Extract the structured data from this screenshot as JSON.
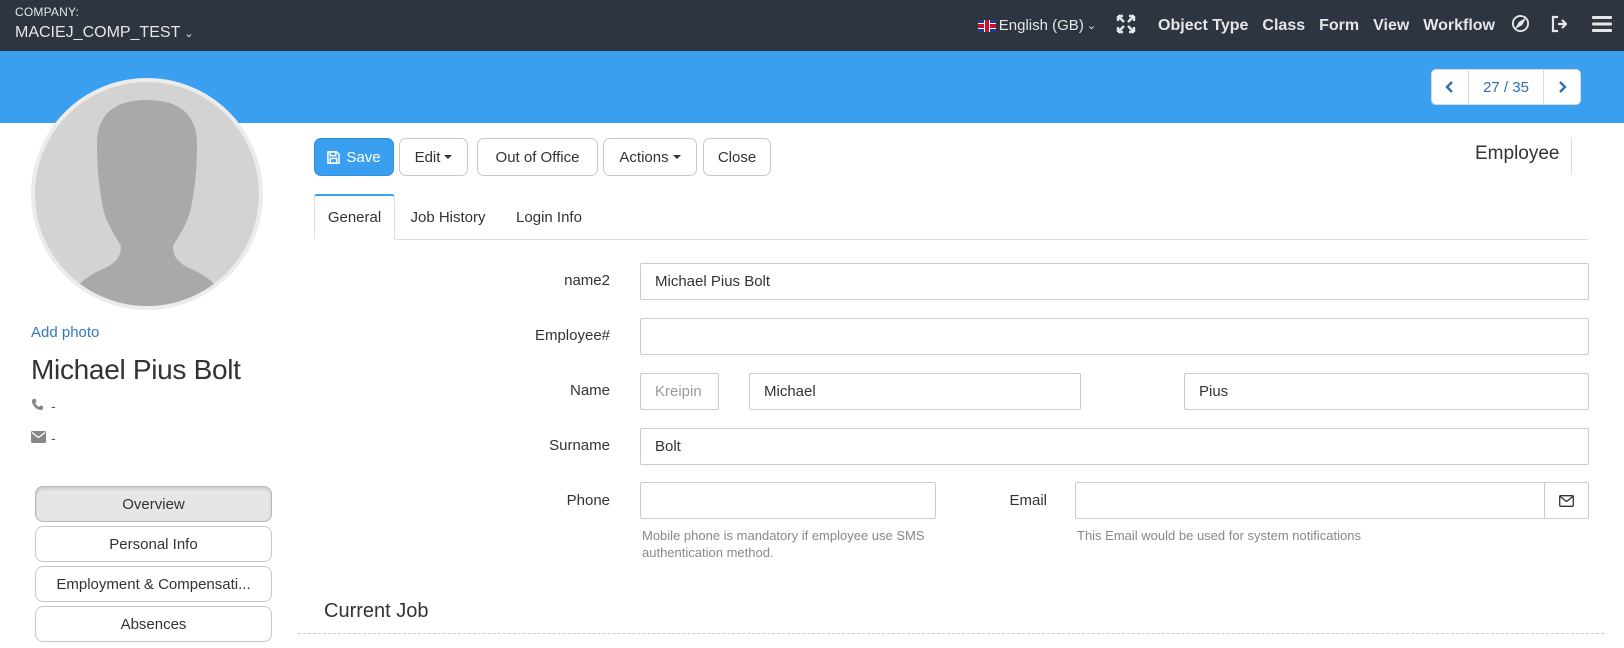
{
  "topbar": {
    "company_label": "COMPANY:",
    "company_name": "MACIEJ_COMP_TEST",
    "language": "English (GB)",
    "nav_links": [
      "Object Type",
      "Class",
      "Form",
      "View",
      "Workflow"
    ]
  },
  "pager": {
    "count": "27 / 35"
  },
  "profile": {
    "add_photo": "Add photo",
    "full_name": "Michael Pius Bolt",
    "phone": "-",
    "email": "-"
  },
  "side_menu": [
    "Overview",
    "Personal Info",
    "Employment & Compensati...",
    "Absences"
  ],
  "toolbar": {
    "save": "Save",
    "edit": "Edit",
    "out_of_office": "Out of Office",
    "actions": "Actions",
    "close": "Close",
    "object_type": "Employee"
  },
  "tabs": [
    "General",
    "Job History",
    "Login Info"
  ],
  "form": {
    "name2_label": "name2",
    "name2_value": "Michael Pius Bolt",
    "employee_no_label": "Employee#",
    "employee_no_value": "",
    "name_label": "Name",
    "name_prefix_placeholder": "Kreipin",
    "first_name": "Michael",
    "middle_name": "Pius",
    "surname_label": "Surname",
    "surname_value": "Bolt",
    "phone_label": "Phone",
    "phone_value": "",
    "phone_help": "Mobile phone is mandatory if employee use SMS authentication method.",
    "email_label": "Email",
    "email_value": "",
    "email_help": "This Email would be used for system notifications"
  },
  "sections": {
    "current_job": "Current Job"
  },
  "colors": {
    "navbar": "#2c3540",
    "accent": "#3b9ff0",
    "link": "#2f7ac2"
  }
}
